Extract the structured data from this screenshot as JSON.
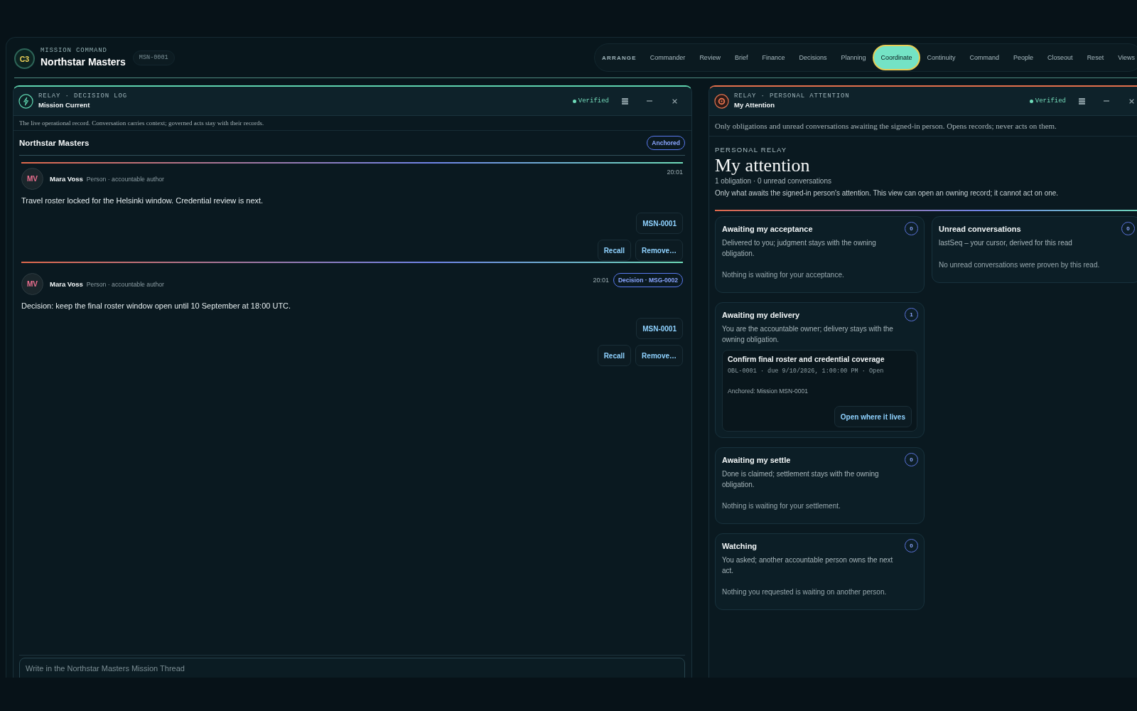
{
  "app": {
    "logo": "C3",
    "eyebrow": "MISSION COMMAND",
    "title": "Northstar Masters",
    "badge": "MSN-0001"
  },
  "nav": {
    "label": "ARRANGE",
    "items": [
      {
        "label": "Commander",
        "selected": false
      },
      {
        "label": "Review",
        "selected": false
      },
      {
        "label": "Brief",
        "selected": false
      },
      {
        "label": "Finance",
        "selected": false
      },
      {
        "label": "Decisions",
        "selected": false
      },
      {
        "label": "Planning",
        "selected": false
      },
      {
        "label": "Coordinate",
        "selected": true
      },
      {
        "label": "Continuity",
        "selected": false
      },
      {
        "label": "Command",
        "selected": false
      },
      {
        "label": "People",
        "selected": false
      },
      {
        "label": "Closeout",
        "selected": false
      },
      {
        "label": "Reset",
        "selected": false
      },
      {
        "label": "Views",
        "selected": false
      }
    ]
  },
  "decision_log": {
    "eyebrow": "RELAY · DECISION LOG",
    "title": "Mission Current",
    "status": "Verified",
    "description": "The live operational record. Conversation carries context; governed acts stay with their records.",
    "thread": {
      "title": "Northstar Masters",
      "tag": "Anchored"
    },
    "messages": [
      {
        "initials": "MV",
        "author": "Mara Voss",
        "role": "Person · accountable author",
        "time": "20:01",
        "body": "Travel roster locked for the Helsinki window. Credential review is next.",
        "record": "MSN-0001",
        "actions": [
          "Recall",
          "Remove…"
        ]
      },
      {
        "initials": "MV",
        "author": "Mara Voss",
        "role": "Person · accountable author",
        "time": "20:01",
        "tag": "Decision · MSG-0002",
        "body": "Decision: keep the final roster window open until 10 September at 18:00 UTC.",
        "record": "MSN-0001",
        "actions": [
          "Recall",
          "Remove…"
        ]
      }
    ],
    "composer": {
      "placeholder": "Write in the Northstar Masters Mission Thread"
    }
  },
  "attention": {
    "eyebrow": "RELAY · PERSONAL ATTENTION",
    "title": "My Attention",
    "status": "Verified",
    "description": "Only obligations and unread conversations awaiting the signed-in person. Opens records; never acts on them.",
    "kicker": "PERSONAL RELAY",
    "heading": "My attention",
    "summary": "1 obligation · 0 unread conversations",
    "note": "Only what awaits the signed-in person's attention. This view can open an owning record; it cannot act on one.",
    "columns": [
      {
        "cards": [
          {
            "title": "Awaiting my acceptance",
            "count": "0",
            "description": "Delivered to you; judgment stays with the owning obligation.",
            "empty": "Nothing is waiting for your acceptance."
          },
          {
            "title": "Awaiting my delivery",
            "count": "1",
            "description": "You are the accountable owner; delivery stays with the owning obligation.",
            "items": [
              {
                "title": "Confirm final roster and credential coverage",
                "meta": "OBL-0001 · due 9/10/2026, 1:00:00 PM · Open",
                "anchor": "Anchored: Mission MSN-0001",
                "action": "Open where it lives"
              }
            ]
          },
          {
            "title": "Awaiting my settle",
            "count": "0",
            "description": "Done is claimed; settlement stays with the owning obligation.",
            "empty": "Nothing is waiting for your settlement."
          },
          {
            "title": "Watching",
            "count": "0",
            "description": "You asked; another accountable person owns the next act.",
            "empty": "Nothing you requested is waiting on another person."
          }
        ]
      },
      {
        "cards": [
          {
            "title": "Unread conversations",
            "count": "0",
            "description": "lastSeq – your cursor, derived for this read",
            "empty": "No unread conversations were proven by this read."
          }
        ]
      }
    ]
  }
}
